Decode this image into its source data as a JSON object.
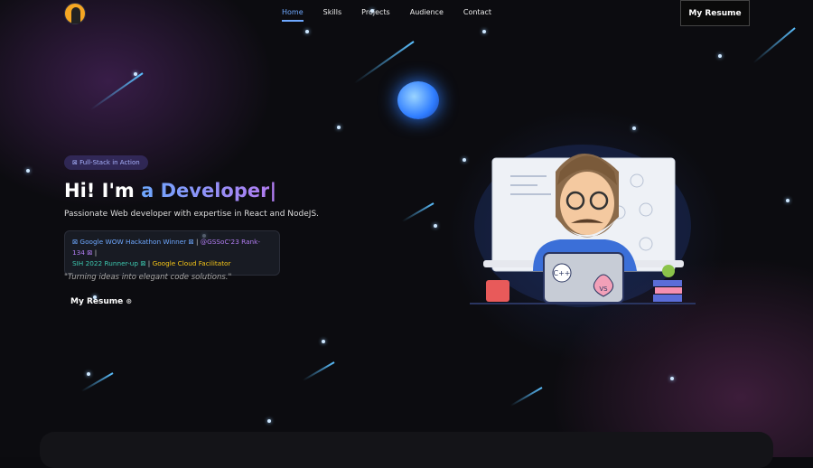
{
  "nav": {
    "links": [
      "Home",
      "Skills",
      "Projects",
      "Audience",
      "Contact"
    ],
    "active": "Home",
    "resume_button": "My Resume"
  },
  "hero": {
    "badge": "⊠ Full-Stack in Action",
    "title_prefix": "Hi! I'm ",
    "title_highlight": "a Developer",
    "caret": "|",
    "subtitle": "Passionate Web developer with expertise in React and NodeJS.",
    "achievements": [
      {
        "text": "⊠ Google WOW Hackathon Winner ⊠",
        "color": "#6ea8ff"
      },
      {
        "text": "@GSSoC'23 Rank-134 ⊠",
        "color": "#b07cf0"
      },
      {
        "text": "SIH 2022 Runner-up ⊠",
        "color": "#3dc9b0"
      },
      {
        "text": "Google Cloud Facilitator",
        "color": "#f5c518"
      }
    ],
    "separator": " | ",
    "quote": "\"Turning ideas into elegant code solutions.\"",
    "resume_button": "My Resume",
    "resume_icon": "⊛"
  },
  "illustration": {
    "laptop_stickers": [
      "C++",
      "VS"
    ]
  }
}
